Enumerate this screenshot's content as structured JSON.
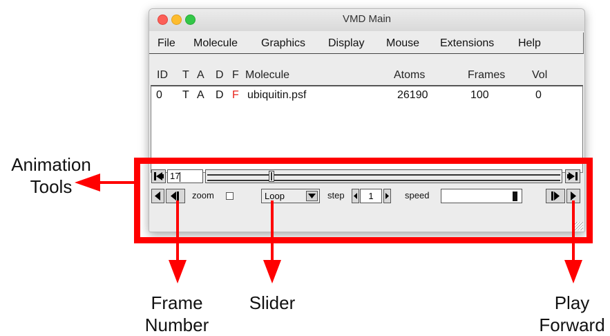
{
  "window": {
    "title": "VMD Main",
    "menu": [
      "File",
      "Molecule",
      "Graphics",
      "Display",
      "Mouse",
      "Extensions",
      "Help"
    ]
  },
  "molecule_table": {
    "headers": {
      "id": "ID",
      "t": "T",
      "a": "A",
      "d": "D",
      "f": "F",
      "molecule": "Molecule",
      "atoms": "Atoms",
      "frames": "Frames",
      "vol": "Vol"
    },
    "rows": [
      {
        "id": "0",
        "t": "T",
        "a": "A",
        "d": "D",
        "f": "F",
        "molecule": "ubiquitin.psf",
        "atoms": "26190",
        "frames": "100",
        "vol": "0"
      }
    ]
  },
  "animation": {
    "frame_number": "17",
    "frame_position_fraction": 0.17,
    "zoom_label": "zoom",
    "loop_value": "Loop",
    "step_label": "step",
    "step_value": "1",
    "speed_label": "speed",
    "speed_fraction": 1.0
  },
  "annotations": {
    "animation_tools": [
      "Animation",
      "Tools"
    ],
    "frame_number": [
      "Frame",
      "Number"
    ],
    "slider": "Slider",
    "play_forward": [
      "Play",
      "Forward"
    ],
    "color": "#ff0000"
  },
  "colors": {
    "flag_red": "#e8221a",
    "traffic_close": "#fc5f57",
    "traffic_min": "#fdbc2e",
    "traffic_max": "#33c748"
  }
}
